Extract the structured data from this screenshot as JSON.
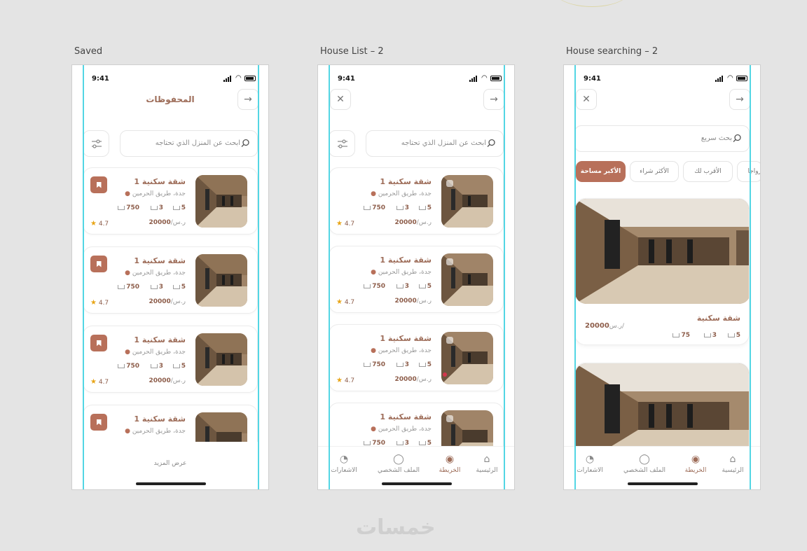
{
  "frames": {
    "saved": {
      "label": "Saved"
    },
    "house_list": {
      "label": "House List – 2"
    },
    "house_search": {
      "label": "House searching – 2"
    }
  },
  "status_time": "9:41",
  "saved": {
    "title": "المحفوظات",
    "search_placeholder": "ابحث عن المنزل الذي تحتاجه",
    "more": "عرض المزيد"
  },
  "house_list": {
    "search_placeholder": "ابحث عن المنزل الذي تحتاجه"
  },
  "listing": {
    "name": "شقة سكنية 1",
    "location": "جدة، طريق الحرمين",
    "rooms": "5",
    "baths": "3",
    "area": "750",
    "price": "20000",
    "currency": "ر.س/",
    "rating": "4.7"
  },
  "house_search": {
    "search_placeholder": "بحث سريع",
    "chips": [
      "الأكبر مساحة",
      "الأكثر شراء",
      "الأقرب لك",
      "رواجا"
    ],
    "card": {
      "name": "شقة سكنية",
      "rooms": "5",
      "baths": "3",
      "area": "75",
      "price": "20000",
      "currency": "ر.س/"
    }
  },
  "tabs": {
    "home": "الرئيسية",
    "map": "الخريطة",
    "profile": "الملف الشخصي",
    "notifications": "الاشعارات"
  },
  "icons": [
    "arrow-right-icon",
    "close-icon",
    "search-icon",
    "filter-icon",
    "bookmark-icon",
    "location-pin-icon",
    "bed-icon",
    "bath-icon",
    "area-icon",
    "star-icon",
    "home-icon",
    "map-pin-icon",
    "user-icon",
    "bell-icon"
  ],
  "colors": {
    "accent": "#b8705a",
    "title": "#9d6c58",
    "guide": "#53d6e4",
    "star": "#e8a517"
  },
  "watermark": "خمسات"
}
